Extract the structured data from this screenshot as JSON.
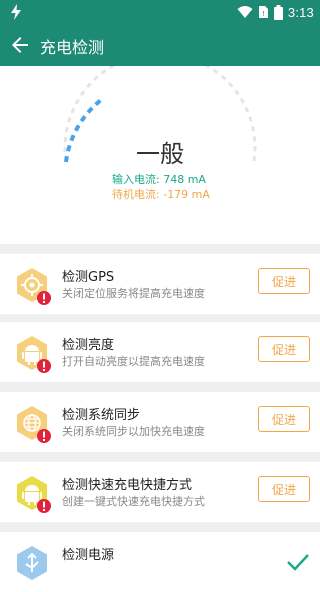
{
  "statusbar": {
    "time": "3:13",
    "icons": [
      "bolt-icon",
      "wifi-icon",
      "sim-icon",
      "battery-icon"
    ]
  },
  "appbar": {
    "title": "充电检测",
    "back_icon": "arrow-left-icon"
  },
  "gauge": {
    "level": "一般",
    "input_label": "输入电流:",
    "input_value": "748 mA",
    "standby_label": "待机电流:",
    "standby_value": "-179 mA",
    "colors": {
      "arc": "#4aa3e8",
      "track": "#e5e5e5",
      "input": "#1aa88a",
      "standby": "#f2a64c"
    }
  },
  "items": [
    {
      "title": "检测GPS",
      "desc": "关闭定位服务将提高充电速度",
      "button": "促进",
      "icon": "gps-icon",
      "status": "warning"
    },
    {
      "title": "检测亮度",
      "desc": "打开自动亮度以提高充电速度",
      "button": "促进",
      "icon": "android-icon",
      "status": "warning"
    },
    {
      "title": "检测系统同步",
      "desc": "关闭系统同步以加快充电速度",
      "button": "促进",
      "icon": "globe-icon",
      "status": "warning"
    },
    {
      "title": "检测快速充电快捷方式",
      "desc": "创建一键式快速充电快捷方式",
      "button": "促进",
      "icon": "android-icon",
      "status": "warning"
    },
    {
      "title": "检测电源",
      "desc": "",
      "button": "",
      "icon": "usb-icon",
      "status": "ok"
    }
  ],
  "colors": {
    "primary": "#1d8a73",
    "accent": "#f2a64c",
    "warning": "#e0223c",
    "icon_bg": "#f6cf7c"
  }
}
